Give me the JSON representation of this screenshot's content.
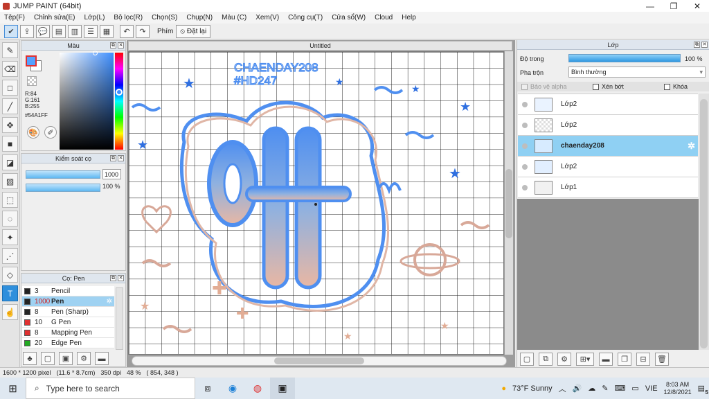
{
  "window": {
    "title": "JUMP PAINT (64bit)"
  },
  "menu": [
    "Tệp(F)",
    "Chỉnh sửa(E)",
    "Lớp(L)",
    "Bộ lọc(R)",
    "Chọn(S)",
    "Chụp(N)",
    "Màu (C)",
    "Xem(V)",
    "Công cụ(T)",
    "Cửa sổ(W)",
    "Cloud",
    "Help"
  ],
  "toolbar": {
    "keys_label": "Phím",
    "reset_label": "Đặt lại"
  },
  "color_panel": {
    "title": "Màu",
    "r": "R:84",
    "g": "G:161",
    "b": "B:255",
    "hex": "#54A1FF",
    "accent": "#54A1FF"
  },
  "brush_control": {
    "title": "Kiểm soát cọ",
    "size": "1000",
    "opacity": "100 %"
  },
  "brush_panel": {
    "title": "Cọ: Pen",
    "items": [
      {
        "size": "3",
        "name": "Pencil",
        "color": "#222222"
      },
      {
        "size": "1000",
        "name": "Pen",
        "color": "#222222"
      },
      {
        "size": "8",
        "name": "Pen (Sharp)",
        "color": "#222222"
      },
      {
        "size": "10",
        "name": "G Pen",
        "color": "#e03030"
      },
      {
        "size": "8",
        "name": "Mapping Pen",
        "color": "#e03030"
      },
      {
        "size": "20",
        "name": "Edge Pen",
        "color": "#22aa22"
      }
    ]
  },
  "canvas": {
    "title": "Untitled",
    "art_text_1": "CHAENDAY208",
    "art_text_2": "#HD247"
  },
  "layer_panel": {
    "title": "Lớp",
    "opacity_label": "Độ trong",
    "opacity_value": "100 %",
    "blend_label": "Pha trộn",
    "blend_value": "Bình thường",
    "protect_alpha": "Bảo vệ alpha",
    "clip": "Xén bớt",
    "lock": "Khóa",
    "layers": [
      {
        "name": "Lớp2"
      },
      {
        "name": "Lớp2"
      },
      {
        "name": "chaenday208"
      },
      {
        "name": "Lớp2"
      },
      {
        "name": "Lớp1"
      }
    ]
  },
  "status": {
    "size": "1600 * 1200 pixel",
    "cm": "(11.6 * 8.7cm)",
    "dpi": "350 dpi",
    "zoom": "48 %",
    "coords": "( 854, 348 )"
  },
  "taskbar": {
    "search_placeholder": "Type here to search",
    "weather": "73°F  Sunny",
    "lang": "VIE",
    "time": "8:03 AM",
    "date": "12/8/2021",
    "notif_count": "5"
  }
}
